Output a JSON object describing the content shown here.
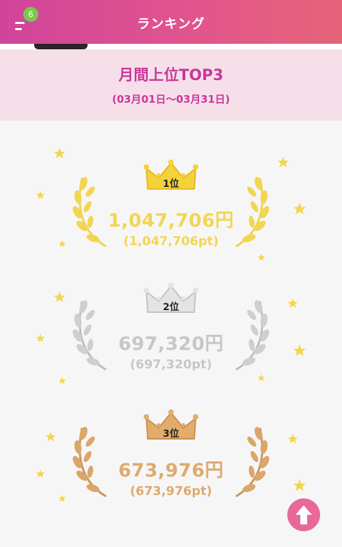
{
  "header": {
    "title": "ランキング",
    "badge_count": "6"
  },
  "period": {
    "title": "月間上位TOP3",
    "range": "(03月01日〜03月31日)"
  },
  "ranking": [
    {
      "rank_label": "1位",
      "amount": "1,047,706円",
      "points": "(1,047,706pt)",
      "color": "#f2d652"
    },
    {
      "rank_label": "2位",
      "amount": "697,320円",
      "points": "(697,320pt)",
      "color": "#c7c7c7"
    },
    {
      "rank_label": "3位",
      "amount": "673,976円",
      "points": "(673,976pt)",
      "color": "#deaa6d"
    }
  ],
  "colors": {
    "header_gradient_start": "#d0449b",
    "header_gradient_end": "#e56478",
    "title_band": "#f7dfea",
    "title_text": "#c8389b",
    "star": "#f4d64e",
    "badge": "#7ac84a",
    "scroll_button": "#e8689a"
  },
  "icons": {
    "menu": "menu-icon",
    "crown": "crown-icon",
    "wreath": "laurel-wreath-icon",
    "star": "star-icon",
    "scroll_top": "arrow-up-icon"
  }
}
